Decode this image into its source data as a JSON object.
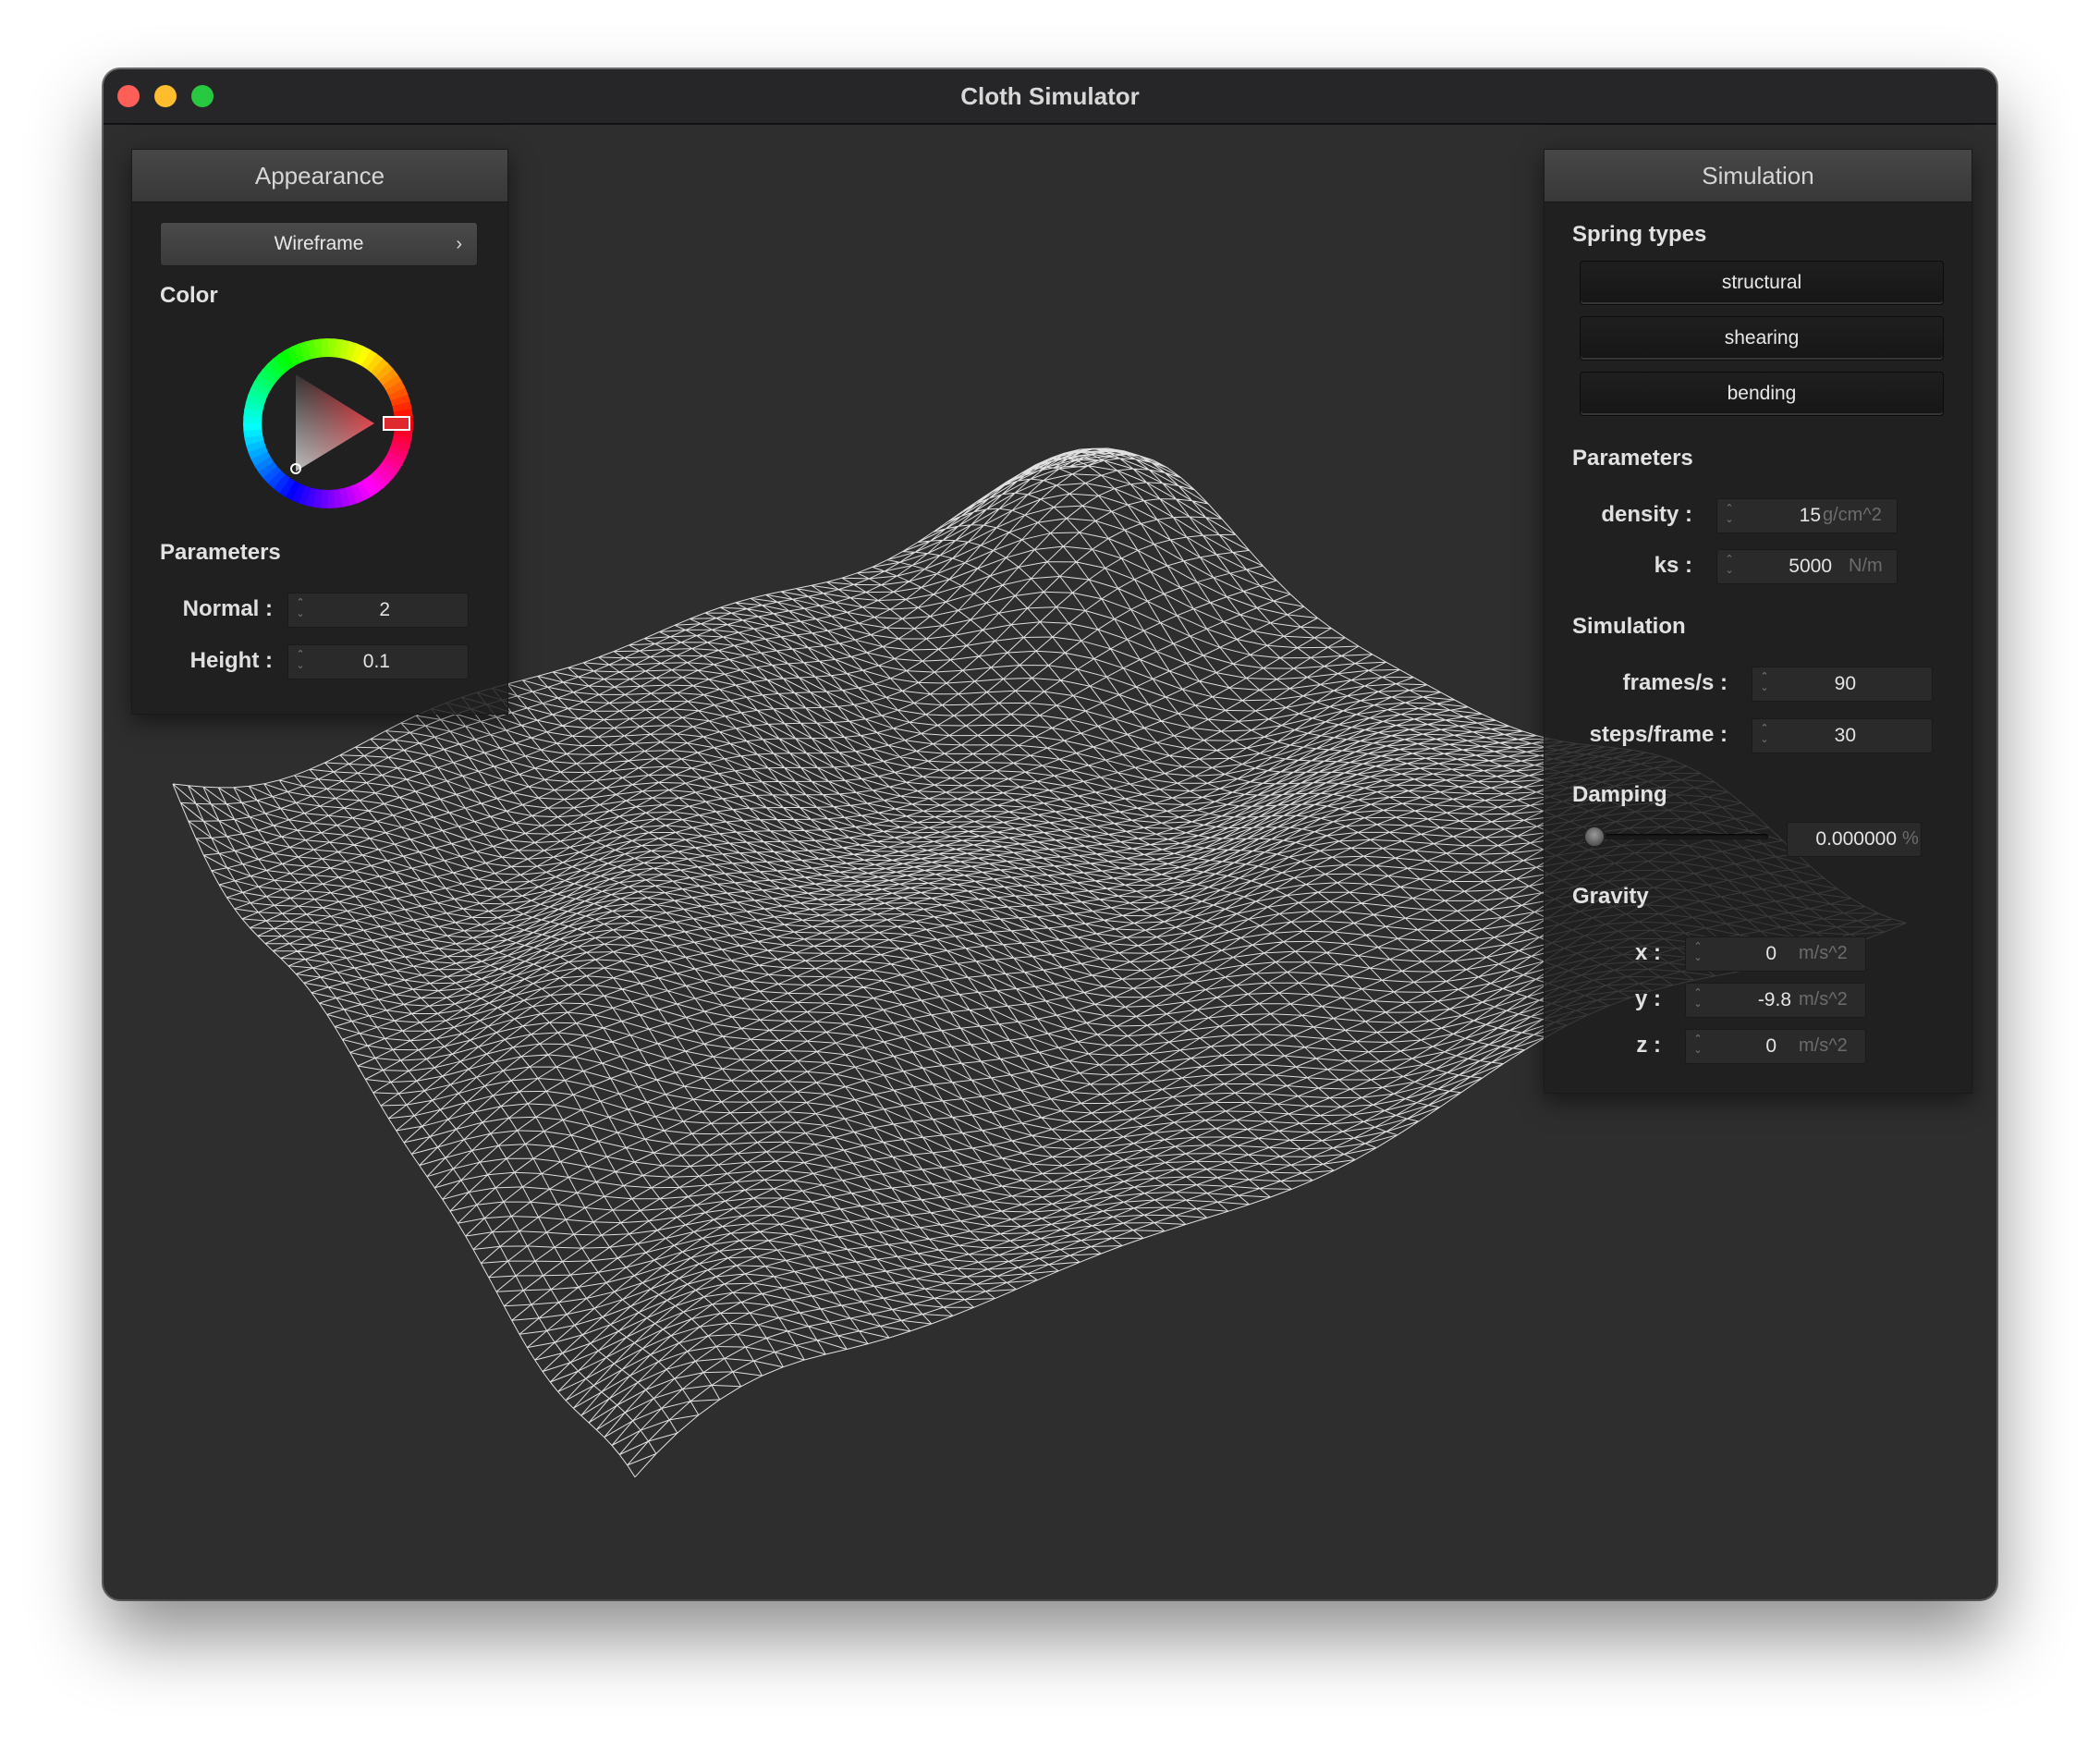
{
  "window": {
    "title": "Cloth Simulator"
  },
  "appearance": {
    "header": "Appearance",
    "shader_button": "Wireframe",
    "color_label": "Color",
    "selected_color": "#e0282f",
    "parameters_label": "Parameters",
    "normal": {
      "label": "Normal :",
      "value": "2"
    },
    "height": {
      "label": "Height :",
      "value": "0.1"
    }
  },
  "simulation": {
    "header": "Simulation",
    "spring_types_label": "Spring types",
    "spring_types": [
      "structural",
      "shearing",
      "bending"
    ],
    "parameters_label": "Parameters",
    "density": {
      "label": "density :",
      "value": "15",
      "unit": "g/cm^2"
    },
    "ks": {
      "label": "ks :",
      "value": "5000",
      "unit": "N/m"
    },
    "simulation_label": "Simulation",
    "frames_per_s": {
      "label": "frames/s :",
      "value": "90"
    },
    "steps_per_frame": {
      "label": "steps/frame :",
      "value": "30"
    },
    "damping_label": "Damping",
    "damping": {
      "value": "0.000000",
      "unit": "%",
      "fraction": 0.0
    },
    "gravity_label": "Gravity",
    "gravity": {
      "x": {
        "label": "x :",
        "value": "0",
        "unit": "m/s^2"
      },
      "y": {
        "label": "y :",
        "value": "-9.8",
        "unit": "m/s^2"
      },
      "z": {
        "label": "z :",
        "value": "0",
        "unit": "m/s^2"
      }
    }
  },
  "colors": {
    "window_bg": "#2e2e2e",
    "wireframe": "#ffffff"
  }
}
